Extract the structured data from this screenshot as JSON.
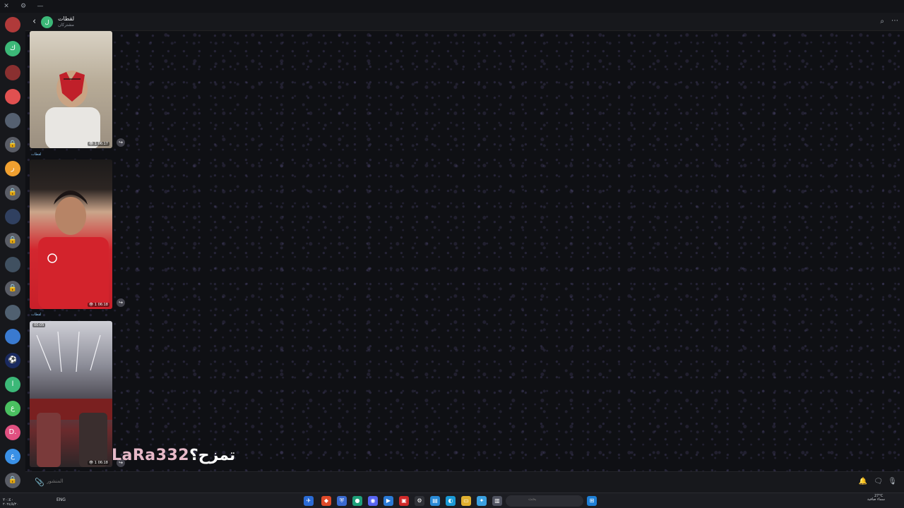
{
  "window": {
    "close_glyph": "✕",
    "settings_glyph": "⚙",
    "minimize_glyph": "—"
  },
  "sidebar": {
    "avatars": [
      {
        "label": "",
        "color": "#b03a3a"
      },
      {
        "label": "ك",
        "color": "#3cb878"
      },
      {
        "label": "",
        "color": "#8a3030"
      },
      {
        "label": "",
        "color": "#e05050"
      },
      {
        "label": "",
        "color": "#556070"
      },
      {
        "label": "🔒",
        "color": "#5a5d66"
      },
      {
        "label": "ر",
        "color": "#f0a030"
      },
      {
        "label": "🔒",
        "color": "#5a5d66"
      },
      {
        "label": "",
        "color": "#304060"
      },
      {
        "label": "🔒",
        "color": "#5a5d66"
      },
      {
        "label": "",
        "color": "#405060"
      },
      {
        "label": "🔒",
        "color": "#5a5d66"
      },
      {
        "label": "",
        "color": "#506070"
      },
      {
        "label": "",
        "color": "#3a7ad0"
      },
      {
        "label": "⚽",
        "color": "#1a2a60"
      },
      {
        "label": "ا",
        "color": "#3cb878"
      },
      {
        "label": "ع",
        "color": "#4ac060"
      },
      {
        "label": "D.",
        "color": "#e05080"
      },
      {
        "label": "ع",
        "color": "#3a90e6"
      },
      {
        "label": "🔒",
        "color": "#5a5d66"
      }
    ]
  },
  "chat": {
    "back_glyph": "‹",
    "avatar_initial": "ل",
    "title": "لقطات",
    "subtitle": "مشتركان",
    "search_icon": "⌕",
    "more_icon": "⋯"
  },
  "messages": [
    {
      "meta": "👁 1 06:17",
      "caption": ""
    },
    {
      "meta": "👁 1 06:18",
      "caption": "لقطات"
    },
    {
      "meta": "👁 1 06:18",
      "caption": "لقطات",
      "duration": "00:05"
    }
  ],
  "forward_glyph": "↪",
  "overlay": {
    "username": "LaRa332",
    "message": "تمزح؟"
  },
  "composer": {
    "placeholder": "المنشور",
    "attach_glyph": "📎",
    "bell": "🔔",
    "emoji": "🗨",
    "mic": "🎙"
  },
  "taskbar": {
    "search_placeholder": "بحث",
    "lang": "ENG",
    "time": "٢٠:٤٠",
    "date": "٢٠٢٤/٥/٢٠",
    "weather_temp": "27°C",
    "weather_desc": "سماء صافية"
  }
}
